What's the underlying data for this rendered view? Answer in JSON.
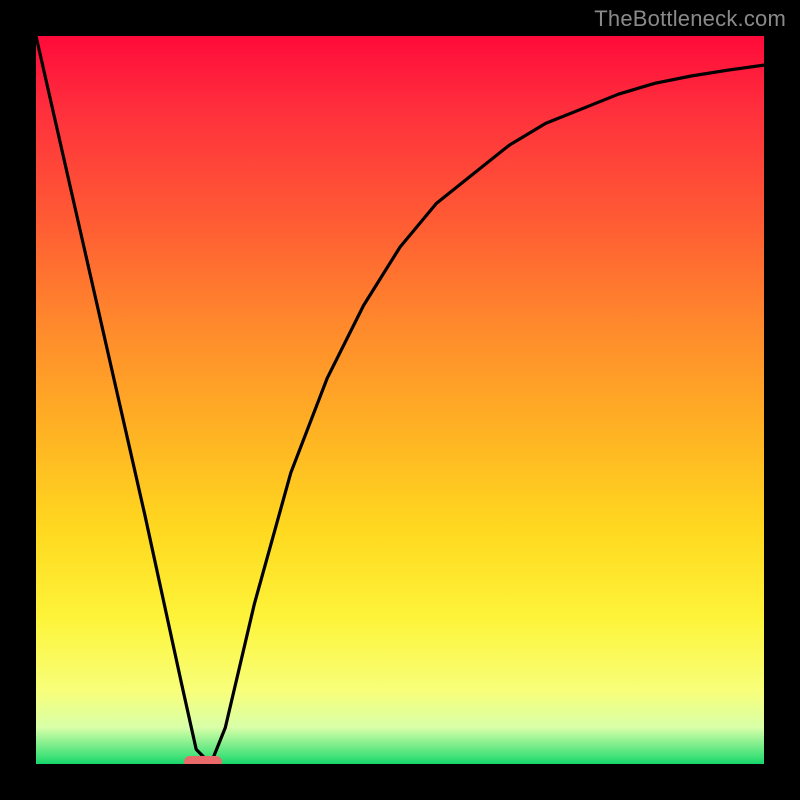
{
  "watermark": "TheBottleneck.com",
  "colors": {
    "frame": "#000000",
    "gradient_top": "#ff0a3a",
    "gradient_mid": "#ffd91f",
    "gradient_bottom": "#16d46a",
    "curve": "#000000",
    "marker": "#e96a6a"
  },
  "chart_data": {
    "type": "line",
    "title": "",
    "xlabel": "",
    "ylabel": "",
    "xlim": [
      0,
      100
    ],
    "ylim": [
      0,
      100
    ],
    "series": [
      {
        "name": "bottleneck-curve",
        "x": [
          0,
          5,
          10,
          15,
          20,
          22,
          24,
          26,
          30,
          35,
          40,
          45,
          50,
          55,
          60,
          65,
          70,
          75,
          80,
          85,
          90,
          95,
          100
        ],
        "values": [
          100,
          78,
          56,
          34,
          11,
          2,
          0,
          5,
          22,
          40,
          53,
          63,
          71,
          77,
          81,
          85,
          88,
          90,
          92,
          93.5,
          94.5,
          95.3,
          96
        ]
      }
    ],
    "annotations": [
      {
        "name": "min-marker",
        "x": 23,
        "y": 0
      }
    ]
  }
}
